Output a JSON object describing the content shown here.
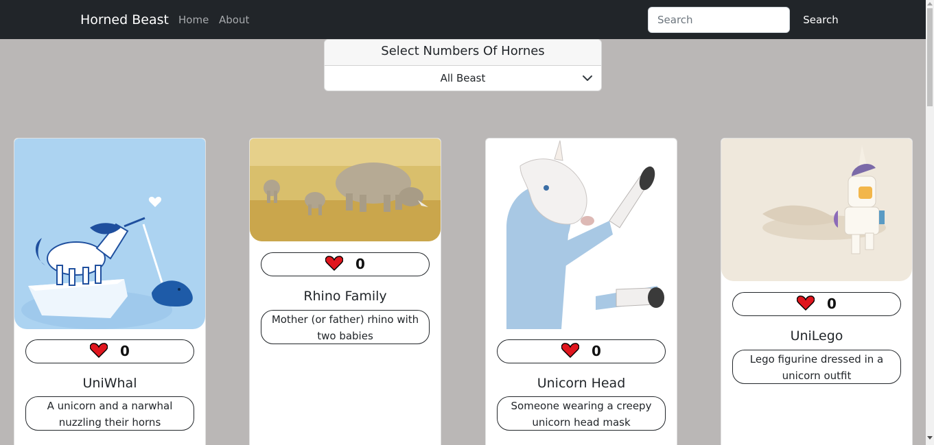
{
  "navbar": {
    "brand": "Horned Beast",
    "links": [
      "Home",
      "About"
    ],
    "search_placeholder": "Search",
    "search_button": "Search"
  },
  "filter": {
    "title": "Select Numbers Of Hornes",
    "selected": "All Beast"
  },
  "cards": [
    {
      "title": "UniWhal",
      "likes": "0",
      "description": "A unicorn and a narwhal nuzzling their horns"
    },
    {
      "title": "Rhino Family",
      "likes": "0",
      "description": "Mother (or father) rhino with two babies"
    },
    {
      "title": "Unicorn Head",
      "likes": "0",
      "description": "Someone wearing a creepy unicorn head mask"
    },
    {
      "title": "UniLego",
      "likes": "0",
      "description": "Lego figurine dressed in a unicorn outfit"
    }
  ],
  "colors": {
    "navbar": "#212529",
    "page_background": "#bab7b6",
    "heart": "#e0161e"
  },
  "icons": [
    "heart-icon",
    "chevron-down-icon"
  ]
}
